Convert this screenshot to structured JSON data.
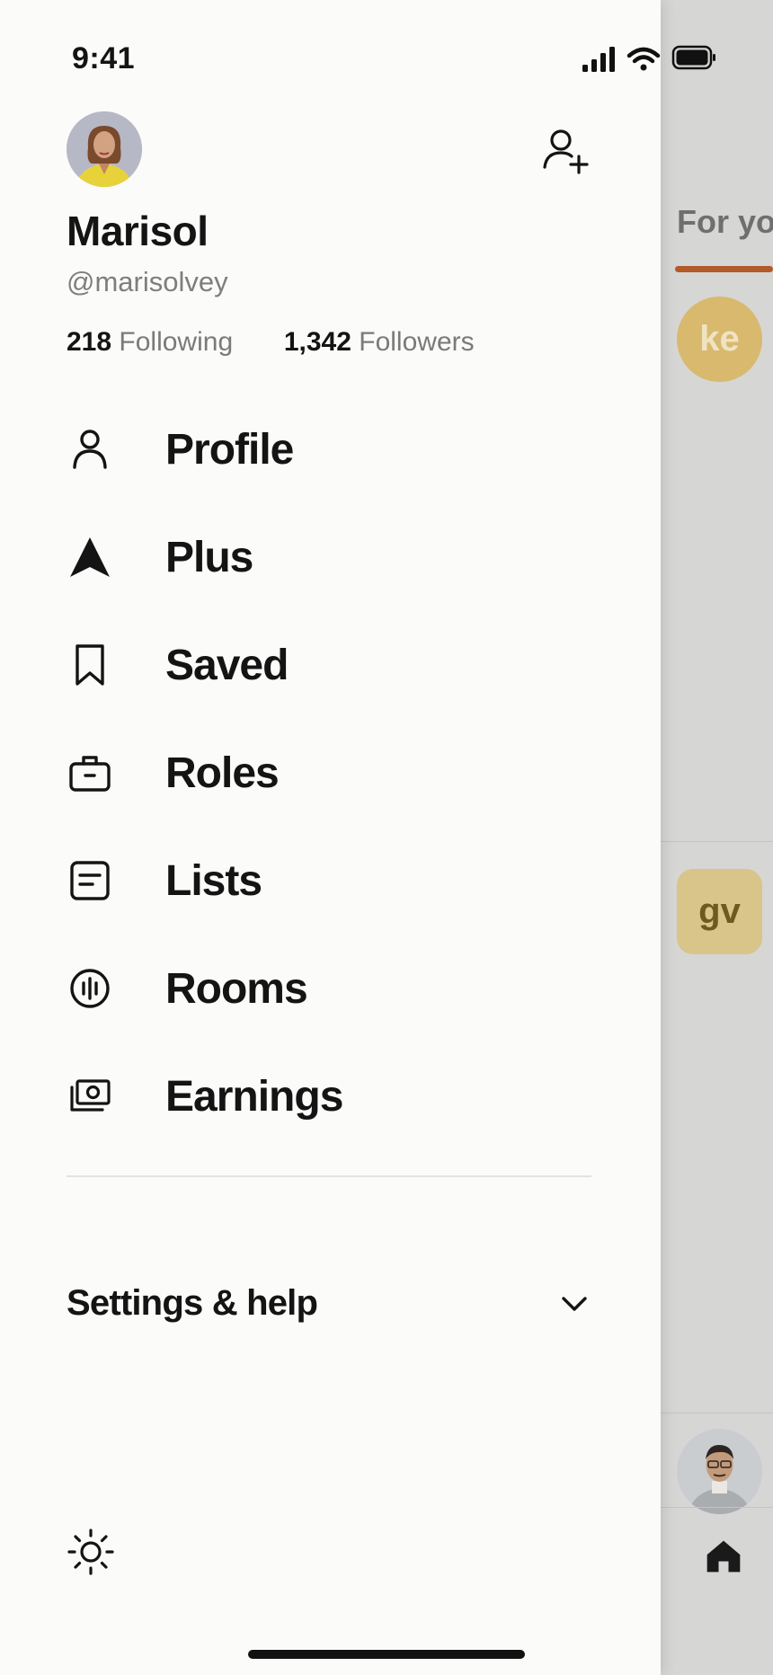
{
  "status_bar": {
    "time": "9:41"
  },
  "profile": {
    "display_name": "Marisol",
    "handle": "@marisolvey",
    "following_count": "218",
    "following_label": "Following",
    "followers_count": "1,342",
    "followers_label": "Followers"
  },
  "menu": {
    "items": [
      {
        "label": "Profile",
        "icon": "person-icon"
      },
      {
        "label": "Plus",
        "icon": "arrow-icon"
      },
      {
        "label": "Saved",
        "icon": "bookmark-icon"
      },
      {
        "label": "Roles",
        "icon": "briefcase-icon"
      },
      {
        "label": "Lists",
        "icon": "list-icon"
      },
      {
        "label": "Rooms",
        "icon": "rooms-icon"
      },
      {
        "label": "Earnings",
        "icon": "money-icon"
      }
    ]
  },
  "settings": {
    "label": "Settings & help"
  },
  "background": {
    "tab_label": "For yo",
    "avatar_ke": "ke",
    "avatar_gv": "gv"
  },
  "colors": {
    "drawer_bg": "#fbfbf9",
    "text_primary": "#141414",
    "text_secondary": "#7e7e7c",
    "accent_underline": "#b25a2a"
  }
}
